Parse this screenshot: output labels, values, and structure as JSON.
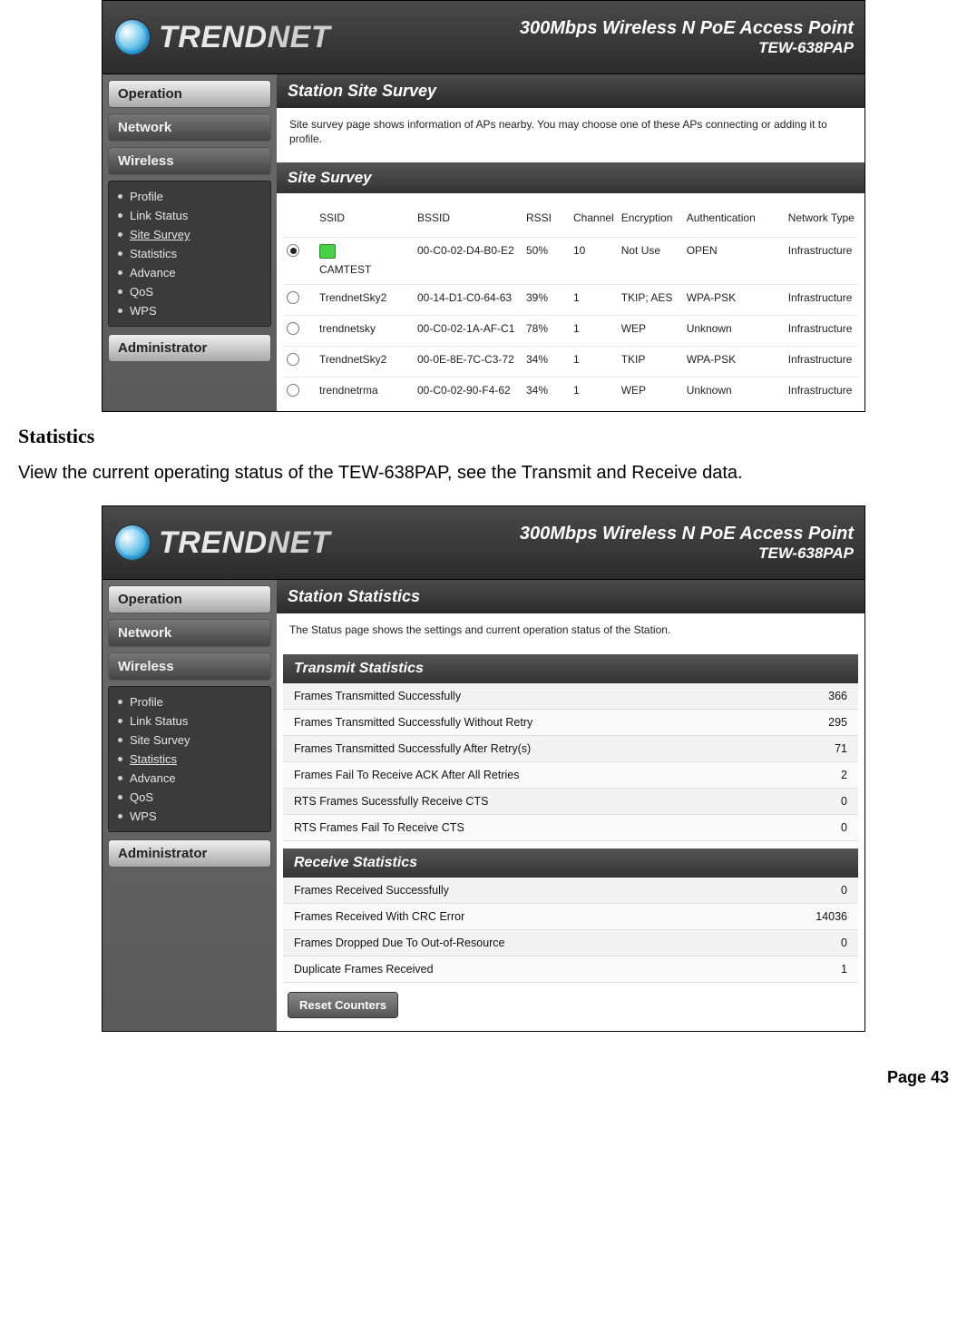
{
  "brand": {
    "name_main": "TREND",
    "name_tail": "NET"
  },
  "header": {
    "line1": "300Mbps Wireless N PoE Access Point",
    "line2": "TEW-638PAP"
  },
  "nav": {
    "buttons": {
      "operation": "Operation",
      "network": "Network",
      "wireless": "Wireless",
      "administrator": "Administrator"
    },
    "sub": [
      "Profile",
      "Link Status",
      "Site Survey",
      "Statistics",
      "Advance",
      "QoS",
      "WPS"
    ]
  },
  "survey": {
    "page_title": "Station Site Survey",
    "desc": "Site survey page shows information of APs nearby. You may choose one of these APs connecting or adding it to profile.",
    "section": "Site Survey",
    "cols": {
      "ssid": "SSID",
      "bssid": "BSSID",
      "rssi": "RSSI",
      "channel": "Channel",
      "encryption": "Encryption",
      "auth": "Authentication",
      "nettype": "Network Type"
    },
    "rows": [
      {
        "selected": true,
        "ssid": "CAMTEST",
        "icon": true,
        "bssid": "00-C0-02-D4-B0-E2",
        "rssi": "50%",
        "ch": "10",
        "enc": "Not Use",
        "auth": "OPEN",
        "net": "Infrastructure"
      },
      {
        "selected": false,
        "ssid": "TrendnetSky2",
        "icon": false,
        "bssid": "00-14-D1-C0-64-63",
        "rssi": "39%",
        "ch": "1",
        "enc": "TKIP; AES",
        "auth": "WPA-PSK",
        "net": "Infrastructure"
      },
      {
        "selected": false,
        "ssid": "trendnetsky",
        "icon": false,
        "bssid": "00-C0-02-1A-AF-C1",
        "rssi": "78%",
        "ch": "1",
        "enc": "WEP",
        "auth": "Unknown",
        "net": "Infrastructure"
      },
      {
        "selected": false,
        "ssid": "TrendnetSky2",
        "icon": false,
        "bssid": "00-0E-8E-7C-C3-72",
        "rssi": "34%",
        "ch": "1",
        "enc": "TKIP",
        "auth": "WPA-PSK",
        "net": "Infrastructure"
      },
      {
        "selected": false,
        "ssid": "trendnetrma",
        "icon": false,
        "bssid": "00-C0-02-90-F4-62",
        "rssi": "34%",
        "ch": "1",
        "enc": "WEP",
        "auth": "Unknown",
        "net": "Infrastructure"
      }
    ],
    "selected_sub": "Site Survey"
  },
  "stats": {
    "page_title": "Station Statistics",
    "desc": "The Status page shows the settings and current operation status of the Station.",
    "tx_title": "Transmit Statistics",
    "rx_title": "Receive Statistics",
    "tx": [
      {
        "k": "Frames Transmitted Successfully",
        "v": "366"
      },
      {
        "k": "Frames Transmitted Successfully Without Retry",
        "v": "295"
      },
      {
        "k": "Frames Transmitted Successfully After Retry(s)",
        "v": "71"
      },
      {
        "k": "Frames Fail To Receive ACK After All Retries",
        "v": "2"
      },
      {
        "k": "RTS Frames Sucessfully Receive CTS",
        "v": "0"
      },
      {
        "k": "RTS Frames Fail To Receive CTS",
        "v": "0"
      }
    ],
    "rx": [
      {
        "k": "Frames Received Successfully",
        "v": "0"
      },
      {
        "k": "Frames Received With CRC Error",
        "v": "14036"
      },
      {
        "k": "Frames Dropped Due To Out-of-Resource",
        "v": "0"
      },
      {
        "k": "Duplicate Frames Received",
        "v": "1"
      }
    ],
    "reset": "Reset Counters",
    "selected_sub": "Statistics"
  },
  "doc": {
    "heading": "Statistics",
    "para": "View the current operating status of the TEW-638PAP, see the Transmit and Receive data.",
    "footer": "Page  43"
  }
}
